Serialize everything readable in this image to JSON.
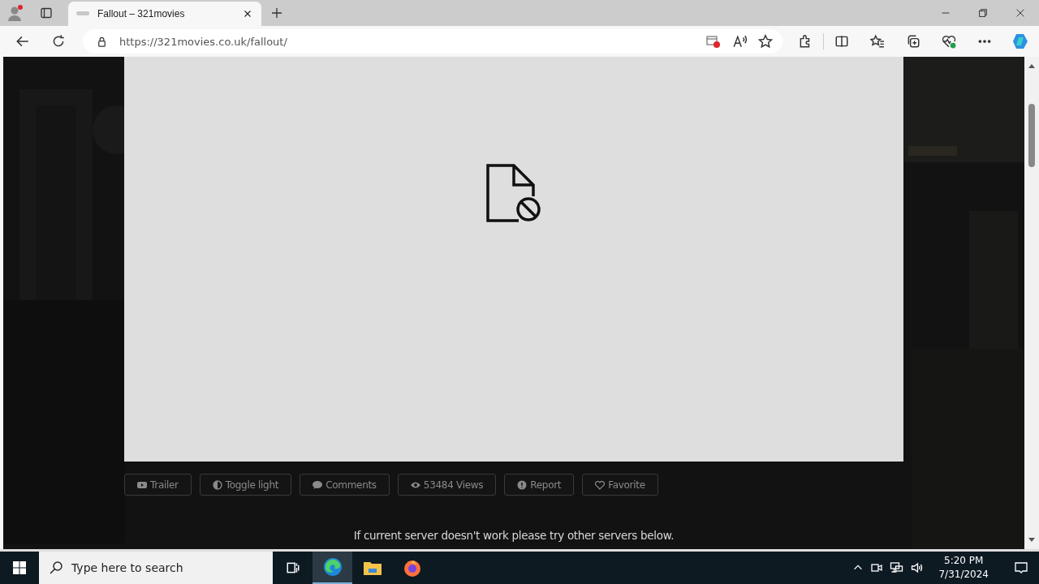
{
  "browser": {
    "tab": {
      "title": "Fallout – 321movies",
      "selected": true
    },
    "url": "https://321movies.co.uk/fallout/"
  },
  "actions": [
    {
      "label": "Trailer",
      "kind": "video"
    },
    {
      "label": "Toggle light",
      "kind": "contrast"
    },
    {
      "label": "Comments",
      "kind": "comment"
    },
    {
      "label": "53484 Views",
      "kind": "eye"
    },
    {
      "label": "Report",
      "kind": "alert"
    },
    {
      "label": "Favorite",
      "kind": "heart"
    }
  ],
  "notice": "If current server doesn't work please try other servers below.",
  "taskbar": {
    "search": {
      "placeholder": "Type here to search"
    },
    "apps": [
      {
        "kind": "taskview",
        "selected": false
      },
      {
        "kind": "edge",
        "selected": true
      },
      {
        "kind": "folder",
        "selected": false
      },
      {
        "kind": "firefox",
        "selected": false
      }
    ],
    "time": "5:20 PM",
    "date": "7/31/2024"
  }
}
